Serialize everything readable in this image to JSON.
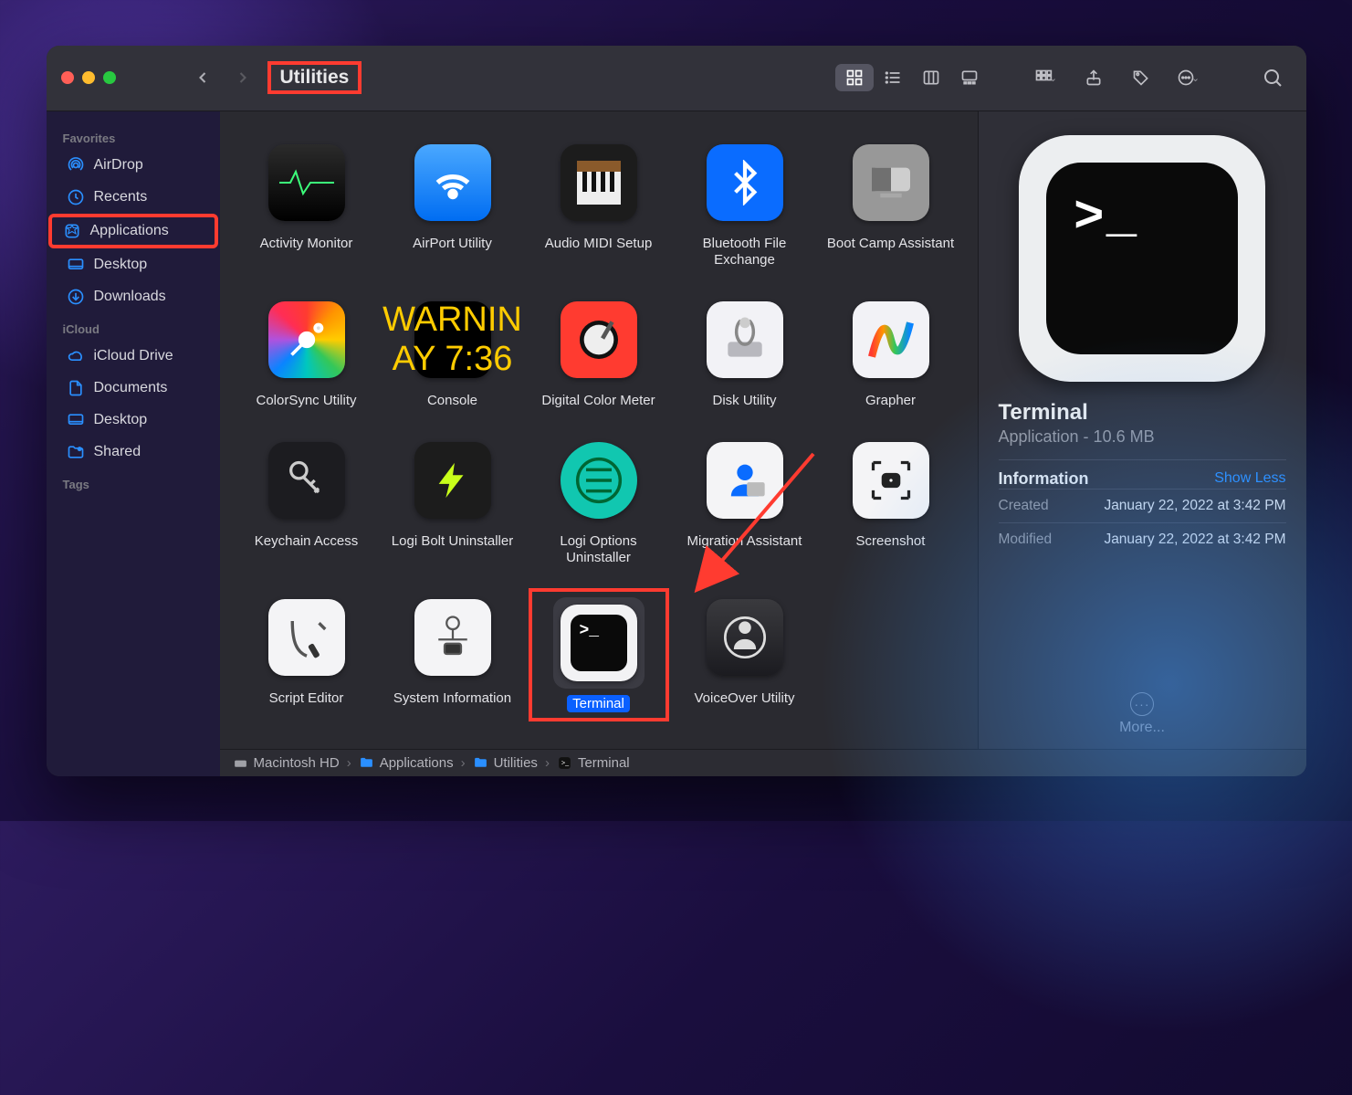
{
  "toolbar": {
    "title": "Utilities"
  },
  "sidebar": {
    "sections": [
      {
        "heading": "Favorites",
        "items": [
          {
            "label": "AirDrop"
          },
          {
            "label": "Recents"
          },
          {
            "label": "Applications"
          },
          {
            "label": "Desktop"
          },
          {
            "label": "Downloads"
          }
        ]
      },
      {
        "heading": "iCloud",
        "items": [
          {
            "label": "iCloud Drive"
          },
          {
            "label": "Documents"
          },
          {
            "label": "Desktop"
          },
          {
            "label": "Shared"
          }
        ]
      },
      {
        "heading": "Tags",
        "items": []
      }
    ]
  },
  "grid": {
    "apps": [
      {
        "label": "Activity Monitor"
      },
      {
        "label": "AirPort Utility"
      },
      {
        "label": "Audio MIDI Setup"
      },
      {
        "label": "Bluetooth File Exchange"
      },
      {
        "label": "Boot Camp Assistant"
      },
      {
        "label": "ColorSync Utility"
      },
      {
        "label": "Console",
        "tile_text": "WARNIN\nAY 7:36"
      },
      {
        "label": "Digital Color Meter"
      },
      {
        "label": "Disk Utility"
      },
      {
        "label": "Grapher"
      },
      {
        "label": "Keychain Access"
      },
      {
        "label": "Logi Bolt Uninstaller"
      },
      {
        "label": "Logi Options Uninstaller"
      },
      {
        "label": "Migration Assistant"
      },
      {
        "label": "Screenshot"
      },
      {
        "label": "Script Editor"
      },
      {
        "label": "System Information"
      },
      {
        "label": "Terminal"
      },
      {
        "label": "VoiceOver Utility"
      }
    ]
  },
  "preview": {
    "name": "Terminal",
    "kind_size": "Application - 10.6 MB",
    "info_heading": "Information",
    "show_less": "Show Less",
    "rows": [
      {
        "k": "Created",
        "v": "January 22, 2022 at 3:42 PM"
      },
      {
        "k": "Modified",
        "v": "January 22, 2022 at 3:42 PM"
      }
    ],
    "more": "More..."
  },
  "pathbar": {
    "crumbs": [
      "Macintosh HD",
      "Applications",
      "Utilities",
      "Terminal"
    ]
  }
}
